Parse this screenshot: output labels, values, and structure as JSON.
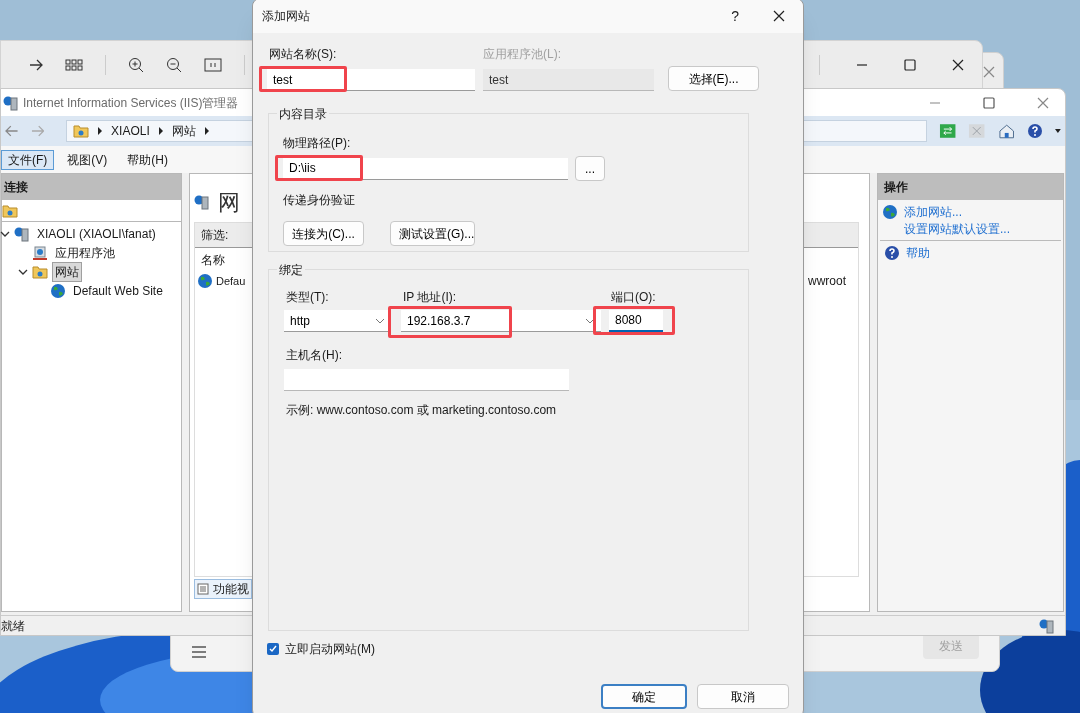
{
  "chat_window": {
    "send_button": {
      "label": "发送",
      "disabled": true
    }
  },
  "iis": {
    "title": "Internet Information Services (IIS)管理器",
    "breadcrumb": [
      "XIAOLI",
      "网站"
    ],
    "menu": [
      {
        "label": "文件(F)",
        "selected": true
      },
      {
        "label": "视图(V)",
        "selected": false
      },
      {
        "label": "帮助(H)",
        "selected": false
      }
    ],
    "connections": {
      "title": "连接",
      "tree": [
        {
          "label": "XIAOLI (XIAOLI\\fanat)",
          "kind": "server",
          "expanded": true,
          "selected": false,
          "children": [
            {
              "label": "应用程序池",
              "kind": "pool",
              "selected": false
            },
            {
              "label": "网站",
              "kind": "sites",
              "expanded": true,
              "selected": true,
              "children": [
                {
                  "label": "Default Web Site",
                  "kind": "site",
                  "selected": false
                }
              ]
            }
          ]
        }
      ]
    },
    "center": {
      "heading": "网",
      "filter_label": "筛选:",
      "column": "名称",
      "rows": [
        {
          "name": "Defau",
          "path": "wwroot"
        }
      ],
      "view_tab": "功能视"
    },
    "actions": {
      "title": "操作",
      "groups": [
        [
          {
            "label": "添加网站...",
            "kind": "globe"
          },
          {
            "label": "设置网站默认设置...",
            "kind": "plain"
          }
        ],
        [
          {
            "label": "帮助",
            "kind": "help"
          }
        ]
      ]
    },
    "status": "就绪"
  },
  "dialog": {
    "title": "添加网站",
    "help": "?",
    "site_name": {
      "label": "网站名称(S):",
      "value": "test",
      "highlighted": true
    },
    "app_pool": {
      "label": "应用程序池(L):",
      "value": "test",
      "disabled": true
    },
    "select_button": "选择(E)...",
    "content_dir": {
      "legend": "内容目录",
      "path": {
        "label": "物理路径(P):",
        "value": "D:\\iis",
        "highlighted": true
      },
      "browse_button": "...",
      "pass_auth": "传递身份验证",
      "buttons": [
        "连接为(C)...",
        "测试设置(G)..."
      ]
    },
    "binding": {
      "legend": "绑定",
      "type": {
        "label": "类型(T):",
        "value": "http"
      },
      "ip": {
        "label": "IP 地址(I):",
        "value": "192.168.3.7",
        "highlighted": true
      },
      "port": {
        "label": "端口(O):",
        "value": "8080",
        "highlighted": true,
        "focused": true
      },
      "host": {
        "label": "主机名(H):"
      },
      "example": "示例: www.contoso.com 或 marketing.contoso.com"
    },
    "start_now": {
      "label": "立即启动网站(M)",
      "checked": true
    },
    "buttons": [
      {
        "label": "确定",
        "default": true
      },
      {
        "label": "取消",
        "default": false
      }
    ]
  }
}
